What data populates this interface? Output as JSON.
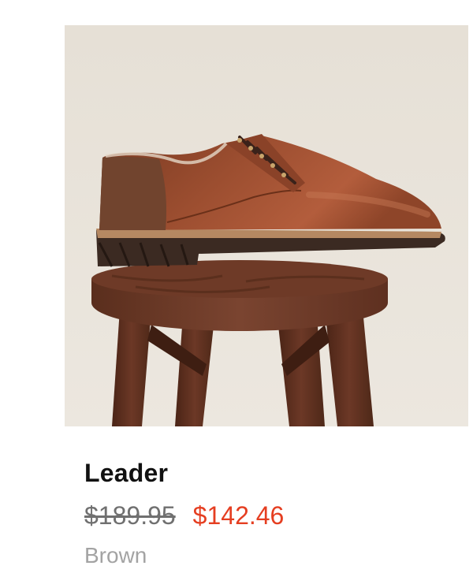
{
  "product": {
    "name": "Leader",
    "original_price": "$189.95",
    "sale_price": "$142.46",
    "color": "Brown"
  },
  "colors": {
    "sale_price": "#e53e21",
    "original_price": "#707070",
    "color_label": "#a3a3a3",
    "image_background": "#e8e2d8"
  }
}
